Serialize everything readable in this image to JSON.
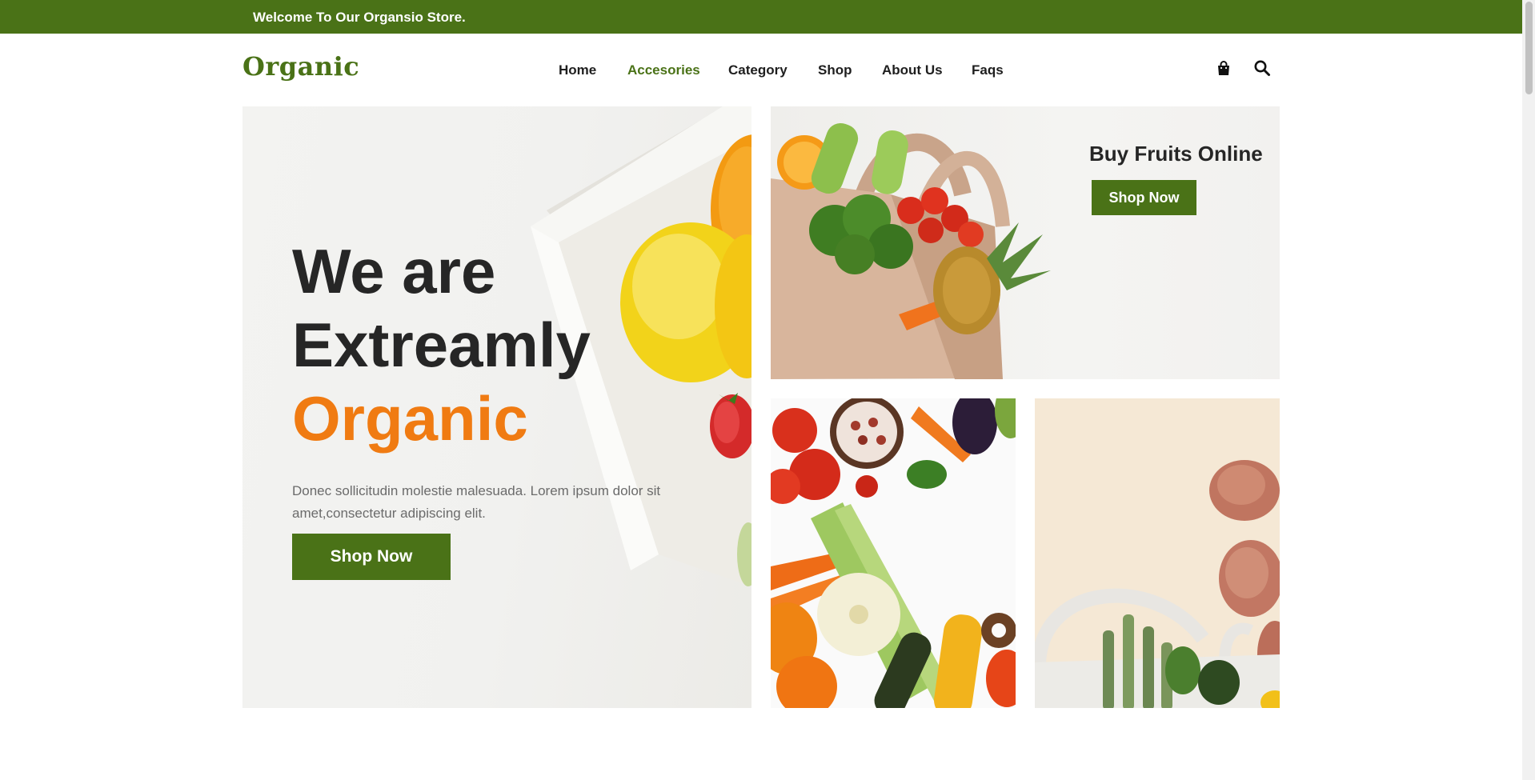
{
  "topbar": {
    "message": "Welcome To Our Organsio Store."
  },
  "header": {
    "logo": "Organic",
    "nav": [
      {
        "label": "Home",
        "active": false
      },
      {
        "label": "Accesories",
        "active": true
      },
      {
        "label": "Category",
        "active": false
      },
      {
        "label": "Shop",
        "active": false
      },
      {
        "label": "About Us",
        "active": false
      },
      {
        "label": "Faqs",
        "active": false
      }
    ],
    "icons": [
      "shopping-bag-icon",
      "search-icon"
    ]
  },
  "hero": {
    "line1": "We are",
    "line2": "Extreamly",
    "line3": "Organic",
    "description": "Donec sollicitudin molestie malesuada. Lorem ipsum dolor sit amet,consectetur adipiscing elit.",
    "button": "Shop Now"
  },
  "promo": {
    "title": "Buy Fruits Online",
    "button": "Shop Now"
  },
  "colors": {
    "brand_green": "#4a7217",
    "accent_orange": "#f07b12",
    "text_dark": "#262626"
  }
}
